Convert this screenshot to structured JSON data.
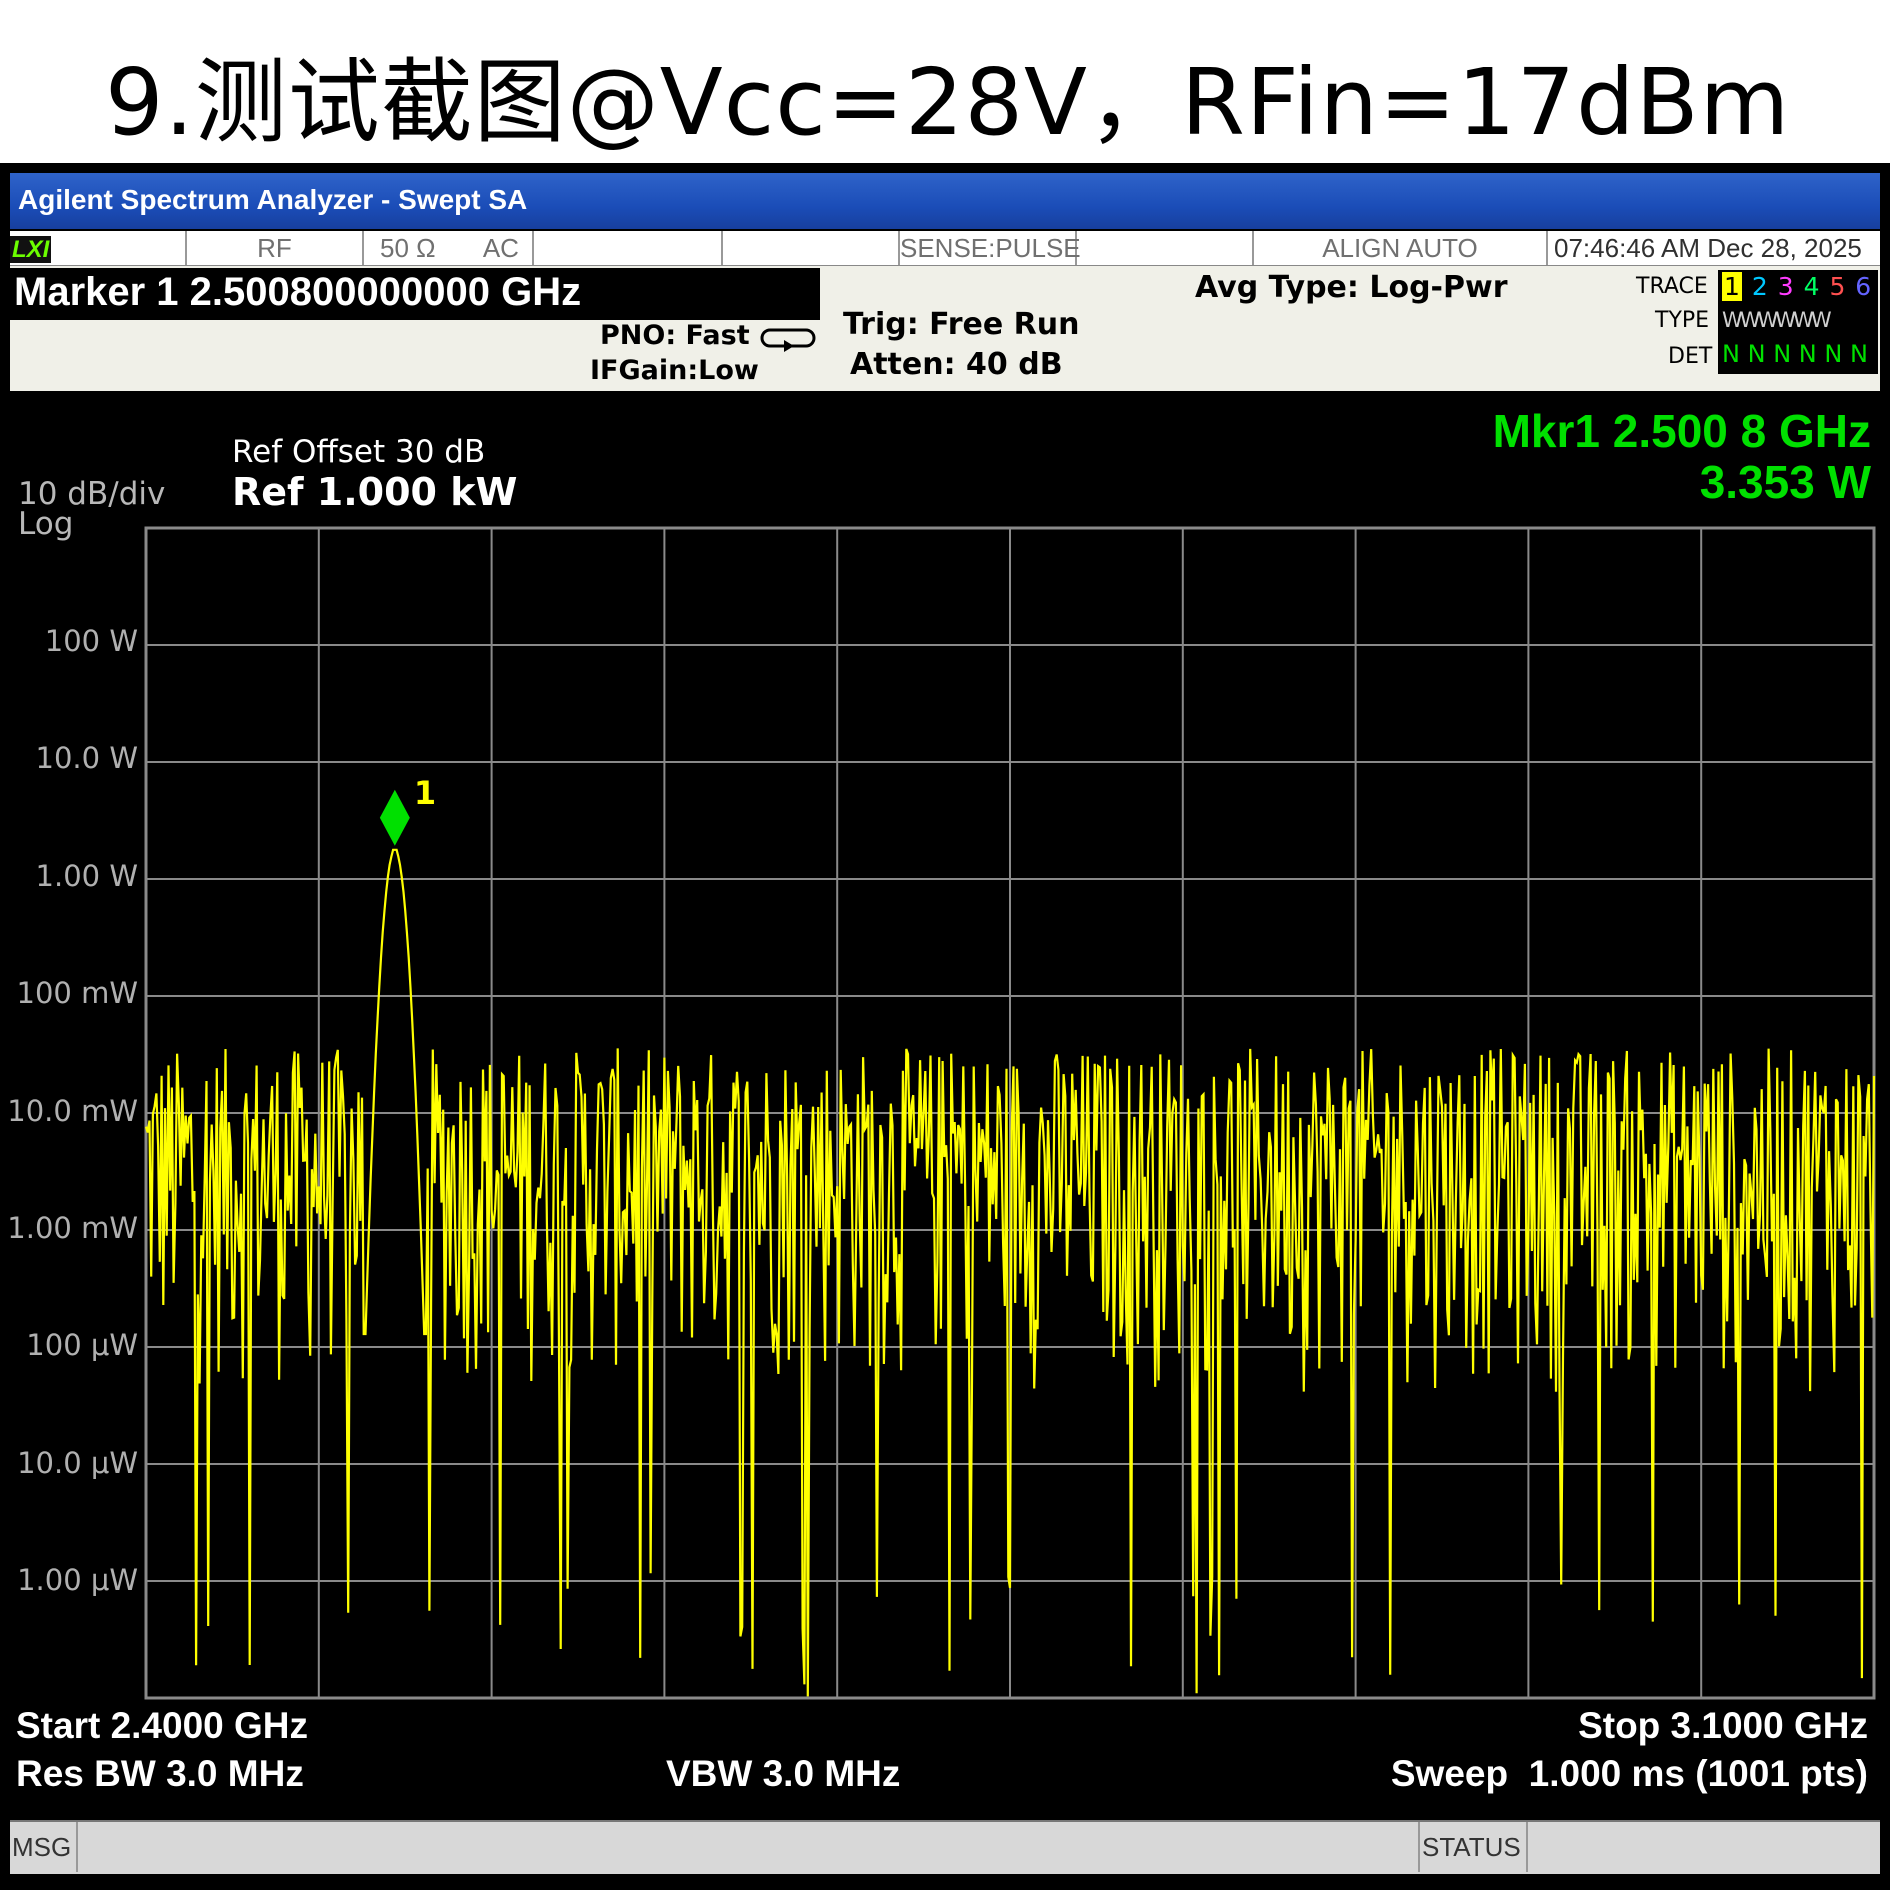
{
  "slide_title": "9.测试截图@Vcc=28V，RFin=17dBm",
  "window": {
    "title": "Agilent Spectrum Analyzer - Swept SA"
  },
  "status_bar": {
    "lxi": "LXI",
    "rf": "RF",
    "impedance": "50 Ω",
    "coupling": "AC",
    "sense": "SENSE:PULSE",
    "align": "ALIGN AUTO",
    "datetime": "07:46:46 AM Dec 28, 2025"
  },
  "marker_header": "Marker 1 2.500800000000 GHz",
  "settings": {
    "pno": "PNO: Fast",
    "ifgain": "IFGain:Low",
    "trig": "Trig: Free Run",
    "atten": "Atten: 40 dB",
    "avg_type": "Avg Type: Log-Pwr"
  },
  "trace_panel": {
    "trace_label": "TRACE",
    "type_label": "TYPE",
    "det_label": "DET",
    "traces": [
      "1",
      "2",
      "3",
      "4",
      "5",
      "6"
    ],
    "trace_colors": [
      "#ffff00",
      "#00c8ff",
      "#ff3cff",
      "#00ff64",
      "#ff5050",
      "#6464ff"
    ],
    "type_values": "WWWWWW",
    "det_values": [
      "N",
      "N",
      "N",
      "N",
      "N",
      "N"
    ]
  },
  "display": {
    "scale": "10 dB/div",
    "scale_type": "Log",
    "ref_offset": "Ref Offset 30 dB",
    "ref_level": "Ref 1.000 kW",
    "marker_readout_freq": "Mkr1 2.500 8 GHz",
    "marker_readout_power": "3.353 W",
    "marker_label": "1",
    "y_labels": [
      "100 W",
      "10.0 W",
      "1.00 W",
      "100 mW",
      "10.0 mW",
      "1.00 mW",
      "100 μW",
      "10.0 μW",
      "1.00 μW"
    ]
  },
  "footer": {
    "start": "Start 2.4000 GHz",
    "stop": "Stop 3.1000 GHz",
    "rbw": "Res BW 3.0 MHz",
    "vbw": "VBW 3.0 MHz",
    "sweep": "Sweep  1.000 ms (1001 pts)"
  },
  "message_bar": {
    "msg": "MSG",
    "status": "STATUS"
  },
  "colors": {
    "trace": "#ffff00",
    "marker": "#00e000",
    "grid": "#8a8a8a",
    "background": "#000000"
  },
  "chart_data": {
    "type": "line",
    "title": "",
    "xlabel": "",
    "ylabel": "",
    "x_unit": "GHz",
    "y_unit": "dBm",
    "xlim": [
      2.4,
      3.1
    ],
    "ylim": [
      -30,
      60
    ],
    "y_scale": "log power, 10 dB/div",
    "grid": true,
    "series": [
      {
        "values_note_free": true,
        "noise_floor_dbm": [
          -7,
          20
        ],
        "peak": {
          "x": 2.5008,
          "y": 35.25
        }
      }
    ],
    "marker": {
      "id": "1",
      "x": 2.5008,
      "y_text": "3.353 W"
    }
  }
}
